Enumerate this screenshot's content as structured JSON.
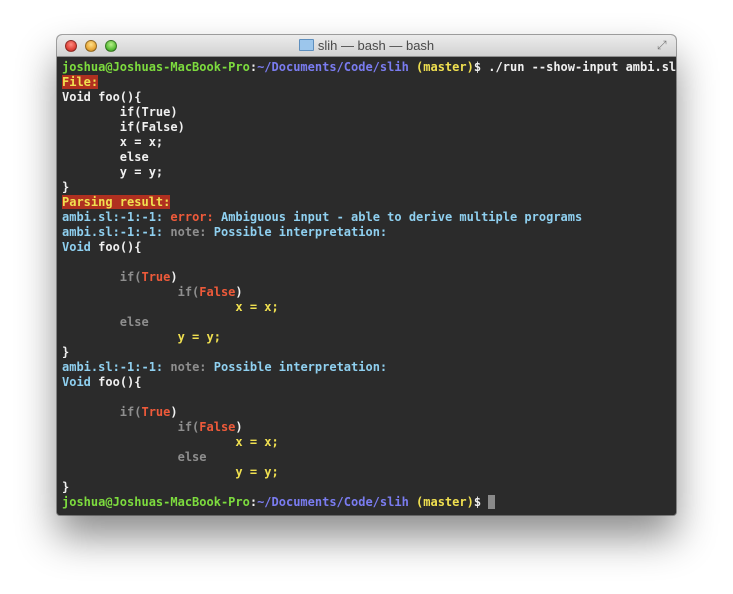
{
  "window": {
    "title": "slih — bash — bash",
    "icons": {
      "folder": "folder-icon",
      "resize": "fullscreen-icon"
    }
  },
  "colors": {
    "prompt_user": "#7ddc3e",
    "prompt_path": "#7a7cf0",
    "prompt_branch": "#f0e050",
    "error": "#ee5a3a",
    "info": "#8fd0f0",
    "note": "#8e8e8e",
    "header_bg": "#b03020",
    "background": "#2b2b2b"
  },
  "terminal": {
    "prompt": {
      "user_host": "joshua@Joshuas-MacBook-Pro",
      "sep": ":",
      "path": "~/Documents/Code/slih",
      "branch": "(master)",
      "symbol": "$"
    },
    "command": "./run --show-input ambi.sl",
    "file_header": "File:",
    "source": [
      "Void foo(){",
      "        if(True)",
      "        if(False)",
      "        x = x;",
      "        else",
      "        y = y;",
      "}"
    ],
    "parsing_header": "Parsing result:",
    "error_line": {
      "loc": "ambi.sl:-1:-1:",
      "kind": "error:",
      "msg": "Ambiguous input - able to derive multiple programs"
    },
    "note_line": {
      "loc": "ambi.sl:-1:-1:",
      "kind": "note:",
      "msg": "Possible interpretation:"
    },
    "tokens": {
      "void": "Void",
      "foo": "foo(){",
      "if": "if(",
      "true": "True",
      "false": "False",
      "close_paren": ")",
      "x_assign": "x = x;",
      "else": "else",
      "y_assign": "y = y;",
      "brace": "}"
    }
  }
}
